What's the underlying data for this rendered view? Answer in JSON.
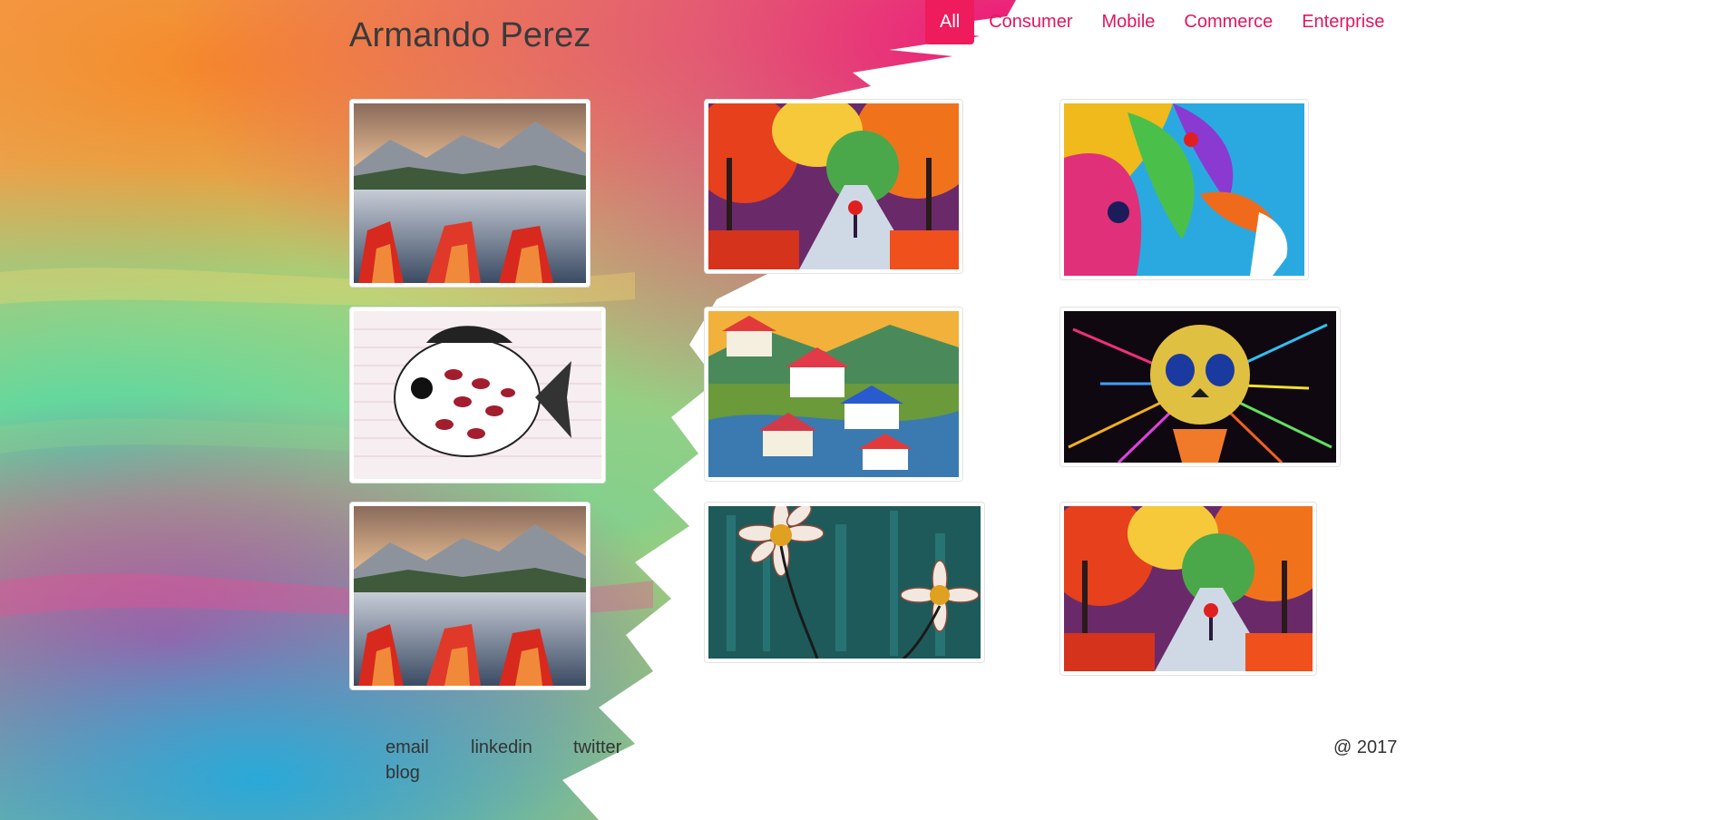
{
  "header": {
    "brand": "Armando Perez"
  },
  "nav": {
    "items": [
      {
        "label": "All",
        "active": true
      },
      {
        "label": "Consumer",
        "active": false
      },
      {
        "label": "Mobile",
        "active": false
      },
      {
        "label": "Commerce",
        "active": false
      },
      {
        "label": "Enterprise",
        "active": false
      }
    ]
  },
  "gallery": {
    "images": [
      {
        "subject": "mountain lake with red boats"
      },
      {
        "subject": "autumn park painting"
      },
      {
        "subject": "psychedelic face art"
      },
      {
        "subject": "patterned fish drawing"
      },
      {
        "subject": "colorful village houses painting"
      },
      {
        "subject": "neon skull art"
      },
      {
        "subject": "mountain lake with red boats"
      },
      {
        "subject": "daisies on teal painting"
      },
      {
        "subject": "autumn park painting"
      }
    ]
  },
  "footer": {
    "links": {
      "email": "email",
      "linkedin": "linkedin",
      "twitter": "twitter",
      "blog": "blog"
    },
    "copyright": "@ 2017"
  },
  "colors": {
    "accent": "#ee1b5d",
    "nav_text": "#e0175f",
    "text": "#333333"
  }
}
